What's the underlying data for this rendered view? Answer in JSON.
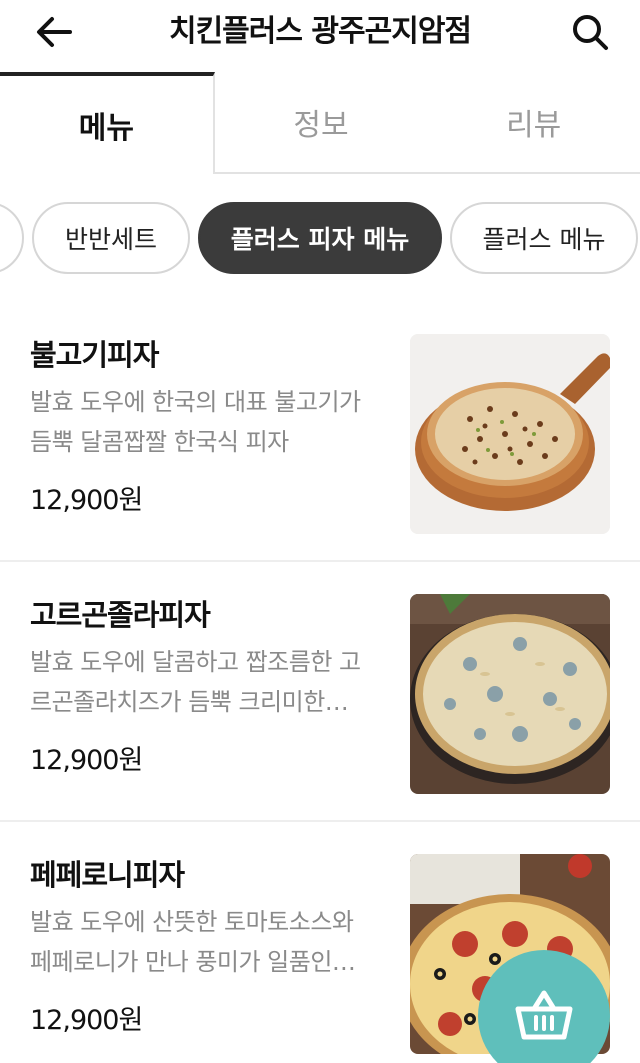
{
  "header": {
    "title": "치킨플러스 광주곤지암점"
  },
  "tabs": [
    {
      "label": "메뉴",
      "active": true
    },
    {
      "label": "정보",
      "active": false
    },
    {
      "label": "리뷰",
      "active": false
    }
  ],
  "categories": [
    {
      "label": "",
      "active": false
    },
    {
      "label": "반반세트",
      "active": false
    },
    {
      "label": "플러스 피자 메뉴",
      "active": true
    },
    {
      "label": "플러스 메뉴",
      "active": false
    }
  ],
  "menu": [
    {
      "name": "불고기피자",
      "desc_line1": "발효 도우에 한국의 대표 불고기가",
      "desc_line2": "듬뿍 달콤짭짤 한국식 피자",
      "price": "12,900원"
    },
    {
      "name": "고르곤졸라피자",
      "desc_line1": "발효 도우에 달콤하고 짭조름한 고",
      "desc_line2": "르곤졸라치즈가 듬뿍 크리미한…",
      "price": "12,900원"
    },
    {
      "name": "페페로니피자",
      "desc_line1": "발효 도우에 산뜻한 토마토소스와",
      "desc_line2": "페페로니가 만나 풍미가 일품인…",
      "price": "12,900원"
    }
  ],
  "icons": {
    "back": "arrow-left-icon",
    "search": "search-icon",
    "cart": "basket-icon"
  },
  "colors": {
    "active_chip": "#3b3b3b",
    "fab": "#5fbfbb"
  }
}
